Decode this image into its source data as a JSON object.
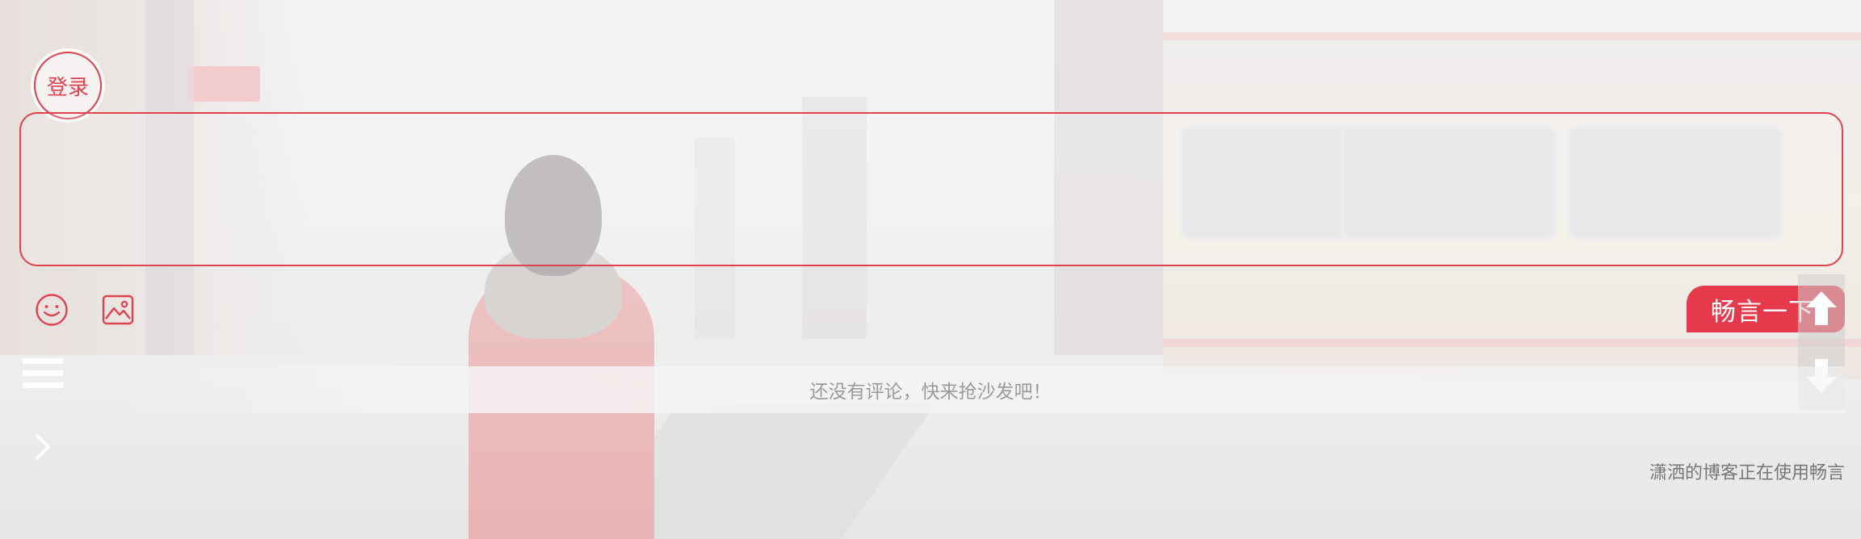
{
  "login": {
    "label": "登录"
  },
  "toolbar": {
    "emoji_icon": "smiley-icon",
    "image_icon": "image-icon",
    "submit_label": "畅言一下"
  },
  "scroll": {
    "up_icon": "arrow-up-icon",
    "down_icon": "arrow-down-icon"
  },
  "side": {
    "menu_icon": "hamburger-menu-icon",
    "expand_icon": "chevron-right-icon"
  },
  "comments": {
    "empty_text": "还没有评论，快来抢沙发吧！"
  },
  "footer": {
    "powered_by": "潇洒的博客正在使用畅言"
  },
  "colors": {
    "accent": "#e0414f",
    "submit_bg": "#e6394b",
    "muted_text": "#9a9a9a"
  }
}
